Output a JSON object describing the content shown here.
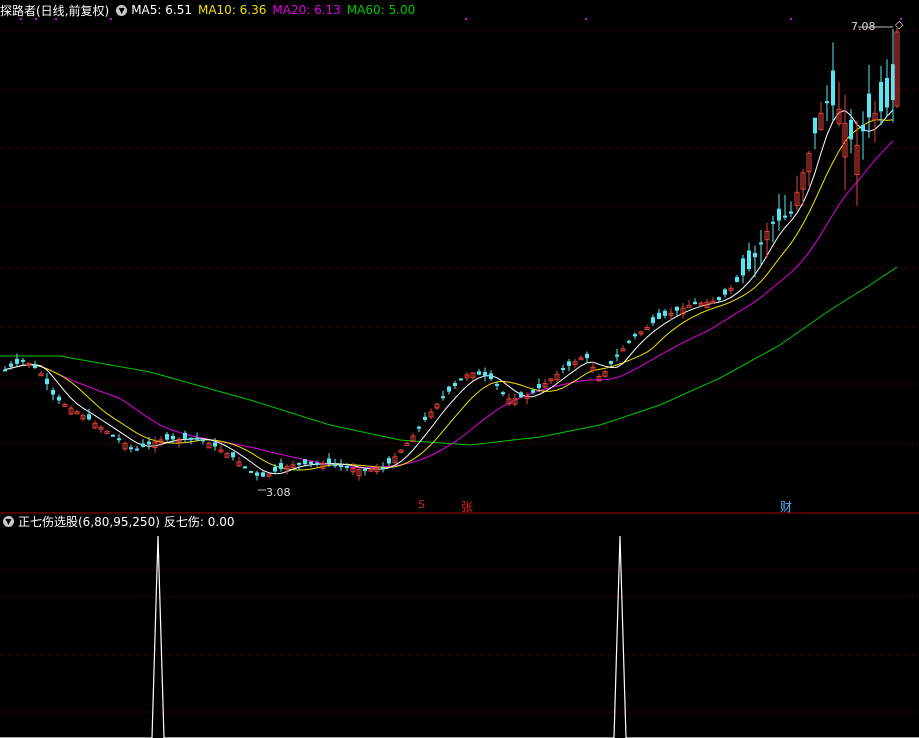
{
  "main_header": {
    "title": "探路者(日线,前复权)",
    "ma5_label": "MA5: 6.51",
    "ma10_label": "MA10: 6.36",
    "ma20_label": "MA20: 6.13",
    "ma60_label": "MA60: 5.00"
  },
  "sub_header": {
    "title": "正七伤选股(6,80,95,250)",
    "value_label": "反七伤: 0.00"
  },
  "annotations": {
    "high": "7.08",
    "low": "3.08",
    "marker_s": "S",
    "marker_zhang": "张",
    "marker_cai": "财"
  },
  "colors": {
    "background": "#000000",
    "grid": "#7a0000",
    "up": "#e0413a",
    "down": "#54e8f5",
    "ma5": "#ffffff",
    "ma10": "#f0e000",
    "ma20": "#e000e0",
    "ma60": "#00c800"
  },
  "chart_data": {
    "type": "candlestick",
    "price_range": [
      2.9,
      7.2
    ],
    "high_price": 7.08,
    "low_price": 3.08,
    "indicator_range": [
      0,
      1
    ],
    "indicator_values_note": "反七伤 spikes occur twice, otherwise 0",
    "ma_values": {
      "MA5": 6.51,
      "MA10": 6.36,
      "MA20": 6.13,
      "MA60": 5.0
    }
  }
}
